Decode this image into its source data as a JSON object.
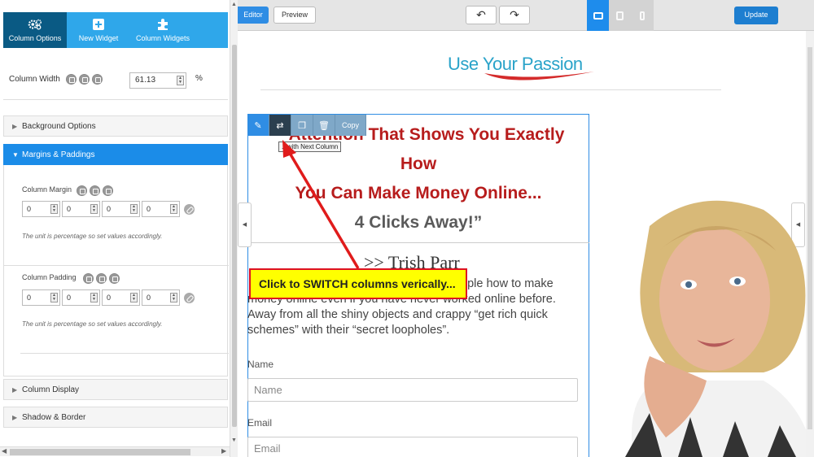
{
  "left_panel": {
    "tabs": [
      {
        "label": "Column Options",
        "icon": "gears-icon",
        "active": true
      },
      {
        "label": "New Widget",
        "icon": "plus-square-icon",
        "active": false
      },
      {
        "label": "Column Widgets",
        "icon": "puzzle-icon",
        "active": false
      }
    ],
    "column_width": {
      "label": "Column Width",
      "value": "61.13",
      "unit": "%"
    },
    "accordions": {
      "background": "Background Options",
      "margins": "Margins & Paddings",
      "display": "Column Display",
      "shadow": "Shadow & Border"
    },
    "margin": {
      "label": "Column Margin",
      "values": [
        "0",
        "0",
        "0",
        "0"
      ],
      "hint": "The unit is percentage so set values accordingly."
    },
    "padding": {
      "label": "Column Padding",
      "values": [
        "0",
        "0",
        "0",
        "0"
      ],
      "hint": "The unit is percentage so set values accordingly."
    }
  },
  "toolbar": {
    "editor_label": "Editor",
    "preview_label": "Preview",
    "update_label": "Update",
    "undo_icon": "↶",
    "redo_icon": "↷"
  },
  "canvas": {
    "logo_text": "Use Your Passion",
    "column_toolbar": {
      "copy_label": "Copy",
      "tooltip": "...with Next Column"
    },
    "headline": [
      "Attention That Shows You Exactly",
      "How",
      "You Can Make Money Online...",
      "4 Clicks Away!”"
    ],
    "author": ">> Trish Parr",
    "body": {
      "line1": "ople how to make",
      "line2": "money online even if you have never worked online before.",
      "line3": "Away from all the shiny objects and crappy “get rich quick",
      "line4": "schemes” with their “secret loopholes”."
    },
    "annotation": "Click to SWITCH columns verically...",
    "form": {
      "name_label": "Name",
      "name_placeholder": "Name",
      "email_label": "Email",
      "email_placeholder": "Email"
    }
  },
  "colors": {
    "accent": "#2fa7ea",
    "active_tab": "#0a5a84",
    "headline_red": "#b71c1c",
    "annotation_yellow": "#ffff00"
  }
}
